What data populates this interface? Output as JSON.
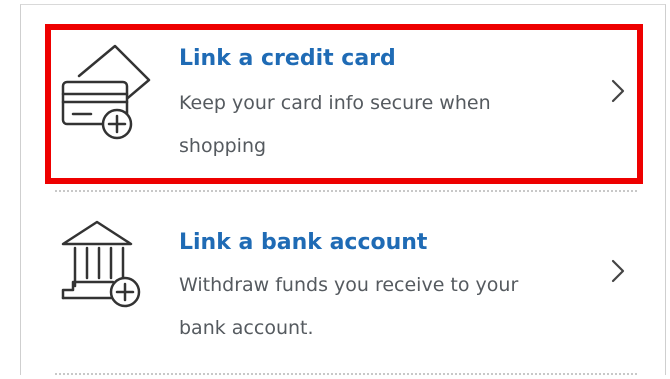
{
  "options": [
    {
      "title": "Link a credit card",
      "description": "Keep your card info secure when shopping",
      "icon": "credit-card-add-icon"
    },
    {
      "title": "Link a bank account",
      "description": "Withdraw funds you receive to your bank account.",
      "icon": "bank-add-icon"
    }
  ],
  "colors": {
    "title": "#1f6bb5",
    "description": "#555a5f",
    "highlight": "#ee0000",
    "icon": "#333333"
  }
}
